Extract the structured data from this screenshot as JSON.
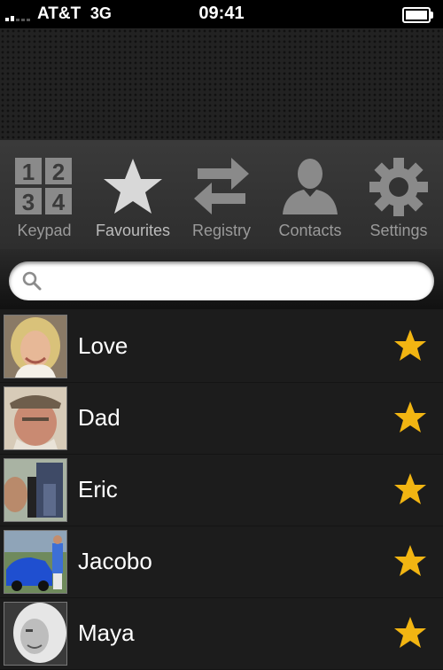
{
  "status": {
    "carrier": "AT&T",
    "network": "3G",
    "time": "09:41"
  },
  "tabs": [
    {
      "label": "Keypad",
      "icon": "keypad-icon",
      "digits": [
        "1",
        "2",
        "3",
        "4"
      ]
    },
    {
      "label": "Favourites",
      "icon": "star-icon",
      "active": true
    },
    {
      "label": "Registry",
      "icon": "swap-arrows-icon"
    },
    {
      "label": "Contacts",
      "icon": "person-icon"
    },
    {
      "label": "Settings",
      "icon": "gear-icon"
    }
  ],
  "search": {
    "placeholder": "",
    "value": ""
  },
  "contacts": [
    {
      "name": "Love",
      "favourite": true
    },
    {
      "name": "Dad",
      "favourite": true
    },
    {
      "name": "Eric",
      "favourite": true
    },
    {
      "name": "Jacobo",
      "favourite": true
    },
    {
      "name": "Maya",
      "favourite": true
    }
  ],
  "colors": {
    "star": "#f2b512",
    "background": "#1c1c1c",
    "tab_icon": "#8e8e8e"
  }
}
